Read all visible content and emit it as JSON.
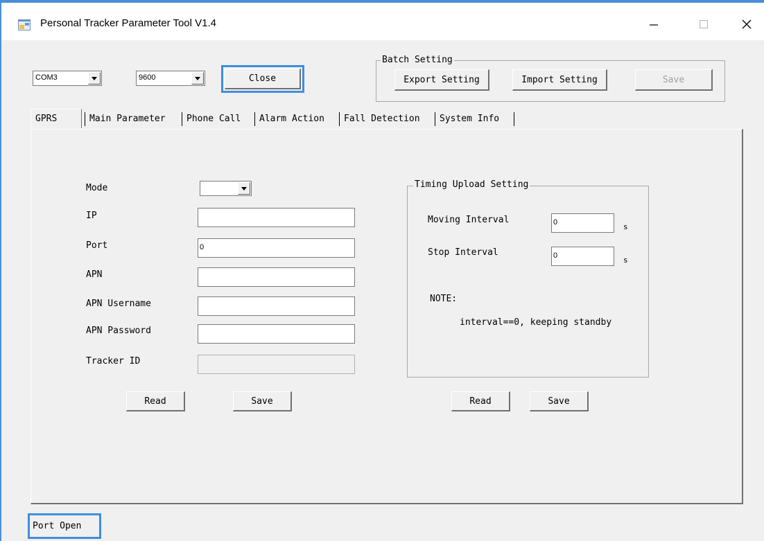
{
  "window": {
    "title": "Personal Tracker Parameter Tool V1.4",
    "controls": {
      "minimize": "minimize-icon",
      "maximize": "maximize-icon",
      "close": "close-icon"
    }
  },
  "toolbar": {
    "port": "COM3",
    "baud": "9600",
    "close_label": "Close"
  },
  "batch": {
    "title": "Batch Setting",
    "export_label": "Export Setting",
    "import_label": "Import Setting",
    "save_label": "Save"
  },
  "tabs": [
    {
      "label": "GPRS"
    },
    {
      "label": "Main Parameter"
    },
    {
      "label": "Phone Call"
    },
    {
      "label": "Alarm Action"
    },
    {
      "label": "Fall Detection"
    },
    {
      "label": "System Info"
    }
  ],
  "gprs": {
    "mode_label": "Mode",
    "mode_value": "",
    "ip_label": "IP",
    "ip_value": "",
    "port_label": "Port",
    "port_value": "0",
    "apn_label": "APN",
    "apn_value": "",
    "apn_user_label": "APN Username",
    "apn_user_value": "",
    "apn_pass_label": "APN Password",
    "apn_pass_value": "",
    "tracker_label": "Tracker ID",
    "tracker_value": "",
    "read_label": "Read",
    "save_label": "Save"
  },
  "timing": {
    "title": "Timing Upload Setting",
    "moving_label": "Moving Interval",
    "moving_value": "0",
    "stop_label": "Stop Interval",
    "stop_value": "0",
    "unit": "s",
    "note_label": "NOTE:",
    "note_text": "interval==0, keeping standby",
    "read_label": "Read",
    "save_label": "Save"
  },
  "status": {
    "text": "Port Open"
  },
  "colors": {
    "accent": "#3d8ee0",
    "window_bg": "#f0f0f0"
  }
}
